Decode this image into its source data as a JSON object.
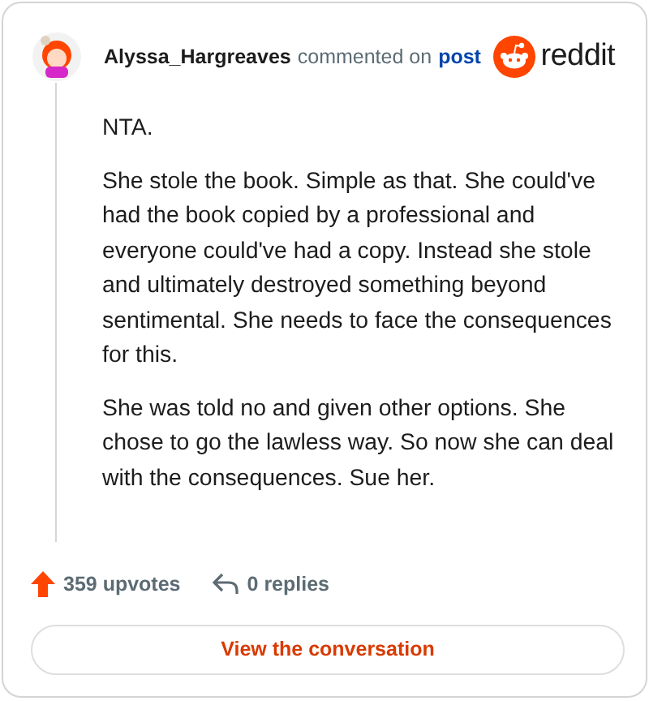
{
  "header": {
    "username": "Alyssa_Hargreaves",
    "action": "commented on",
    "link": "post",
    "brand": "reddit"
  },
  "comment": {
    "paragraphs": [
      "NTA.",
      "She stole the book. Simple as that. She could've had the book copied by a professional and everyone could've had a copy. Instead she stole and ultimately destroyed something beyond sentimental. She needs to face the consequences for this.",
      "She was told no and given other options. She chose to go the lawless way. So now she can deal with the consequences. Sue her."
    ]
  },
  "stats": {
    "upvotes": "359 upvotes",
    "replies": "0 replies"
  },
  "button": "View the conversation"
}
